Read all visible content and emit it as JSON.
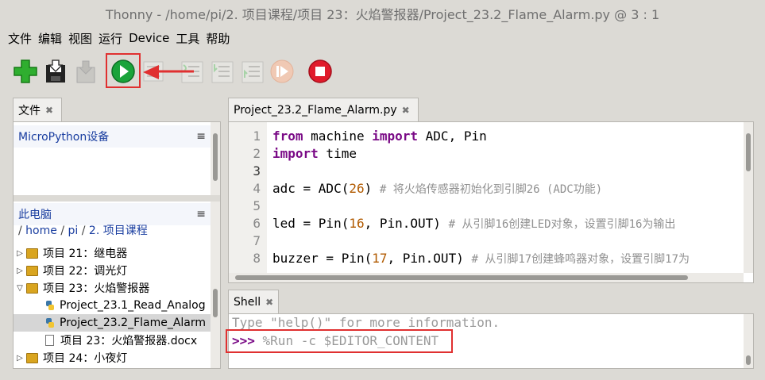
{
  "window": {
    "title": "Thonny  -  /home/pi/2. 项目课程/项目 23：火焰警报器/Project_23.2_Flame_Alarm.py  @  3 : 1"
  },
  "menu": [
    "文件",
    "编辑",
    "视图",
    "运行",
    "Device",
    "工具",
    "帮助"
  ],
  "toolbar": {
    "buttons": [
      "new-icon",
      "save-icon",
      "save-disabled-icon",
      "run-icon",
      "debug-icon",
      "step-over-icon",
      "step-into-icon",
      "step-out-icon",
      "resume-icon",
      "stop-icon"
    ],
    "highlight_color": "#e03030"
  },
  "files_panel": {
    "tab_label": "文件",
    "close_glyph": "✖",
    "micropython_title": "MicroPython设备",
    "menu_glyph": "≡",
    "pc_title": "此电脑",
    "path": [
      "/ ",
      "home",
      " / ",
      "pi",
      " / ",
      "2. 项目课程"
    ],
    "tree": [
      {
        "label": "项目 21：继电器",
        "type": "folder",
        "expanded": false
      },
      {
        "label": "项目 22：调光灯",
        "type": "folder",
        "expanded": false
      },
      {
        "label": "项目 23：火焰警报器",
        "type": "folder",
        "expanded": true
      },
      {
        "label": "Project_23.1_Read_Analog",
        "type": "python",
        "selected": false
      },
      {
        "label": "Project_23.2_Flame_Alarm",
        "type": "python",
        "selected": true
      },
      {
        "label": "项目 23：火焰警报器.docx",
        "type": "doc",
        "selected": false
      },
      {
        "label": "项目 24：小夜灯",
        "type": "folder",
        "expanded": false
      }
    ]
  },
  "editor": {
    "tab_label": "Project_23.2_Flame_Alarm.py",
    "line_numbers": [
      "1",
      "2",
      "3",
      "4",
      "5",
      "6",
      "7",
      "8"
    ],
    "lines": {
      "l1_kw1": "from",
      "l1_a": " machine ",
      "l1_kw2": "import",
      "l1_b": " ADC, Pin",
      "l2_kw": "import",
      "l2_a": " time",
      "l4_a": "adc = ADC(",
      "l4_num": "26",
      "l4_b": ") ",
      "l4_cm": "# 将火焰传感器初始化到引脚26 (ADC功能)",
      "l6_a": "led = Pin(",
      "l6_num": "16",
      "l6_b": ", Pin.OUT) ",
      "l6_cm": "# 从引脚16创建LED对象，设置引脚16为输出",
      "l8_a": "buzzer = Pin(",
      "l8_num": "17",
      "l8_b": ", Pin.OUT) ",
      "l8_cm": "# 从引脚17创建蜂鸣器对象，设置引脚17为"
    }
  },
  "shell": {
    "tab_label": "Shell",
    "hint": "Type \"help()\" for more information.",
    "prompt": ">>>",
    "command": " %Run -c $EDITOR_CONTENT"
  }
}
